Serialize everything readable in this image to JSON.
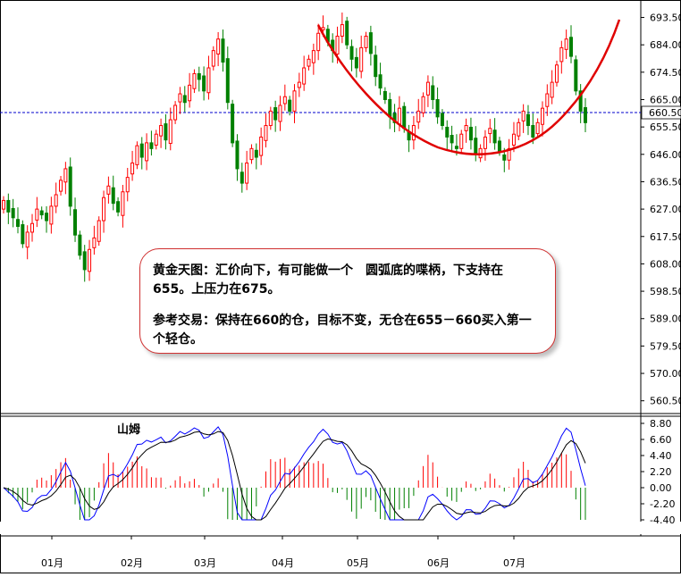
{
  "chart_data": [
    {
      "type": "candlestick",
      "x_ticks": [
        "01月",
        "02月",
        "03月",
        "04月",
        "05月",
        "06月",
        "07月"
      ],
      "y_ticks": [
        "693.50",
        "684.00",
        "674.50",
        "665.00",
        "655.50",
        "646.00",
        "636.50",
        "627.00",
        "617.50",
        "608.00",
        "598.50",
        "589.00",
        "579.50",
        "570.00",
        "560.50"
      ],
      "ylim": [
        557.0,
        698.0
      ],
      "current_price": "660.50",
      "reference_line": 660.5,
      "closes": [
        630,
        626,
        624,
        621,
        615,
        619,
        622,
        627,
        625,
        623,
        628,
        632,
        637,
        641,
        628,
        618,
        611,
        606,
        613,
        617,
        623,
        631,
        635,
        629,
        626,
        633,
        638,
        643,
        649,
        645,
        650,
        648,
        653,
        656,
        651,
        658,
        663,
        667,
        664,
        670,
        674,
        672,
        668,
        676,
        682,
        686,
        678,
        664,
        650,
        641,
        636,
        643,
        648,
        645,
        652,
        656,
        661,
        658,
        663,
        666,
        661,
        668,
        671,
        676,
        679,
        682,
        688,
        690,
        685,
        682,
        687,
        691,
        684,
        679,
        676,
        683,
        687,
        681,
        673,
        669,
        665,
        659,
        657,
        662,
        655,
        651,
        656,
        661,
        666,
        671,
        665,
        659,
        656,
        652,
        650,
        648,
        653,
        656,
        651,
        646,
        648,
        652,
        655,
        650,
        647,
        644,
        648,
        653,
        657,
        661,
        656,
        652,
        657,
        662,
        667,
        671,
        677,
        683,
        686,
        680,
        668,
        661,
        657
      ],
      "trend_arc": "red rounded-bottom arc",
      "annotation": [
        "黄金天图：汇价向下，有可能做一个　圆弧底的喋柄，下支持在655。上压力在675。",
        "参考交易：保持在660的仓，目标不变，无仓在655－660买入第一个轻仓。"
      ]
    },
    {
      "type": "macd",
      "y_ticks": [
        "8.80",
        "6.60",
        "4.40",
        "2.20",
        "0.00",
        "-2.20",
        "-4.40"
      ],
      "ylim": [
        -4.4,
        8.8
      ],
      "label": "山姆"
    }
  ],
  "colors": {
    "up": "#ff0000",
    "down": "#008000",
    "dif": "#0000ff",
    "dea": "#000000",
    "arc": "#e00000",
    "refline": "#0000cc"
  }
}
